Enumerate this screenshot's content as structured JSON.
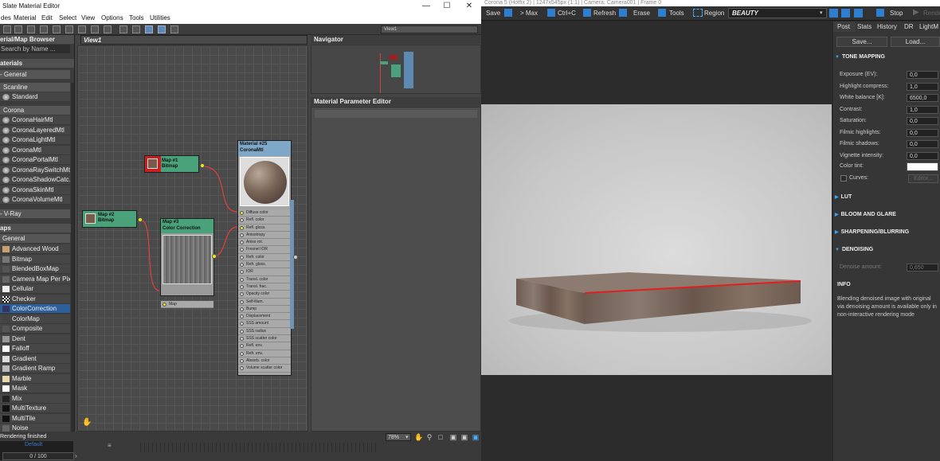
{
  "slate": {
    "title": "Slate Material Editor",
    "menu": [
      "des",
      "Material",
      "Edit",
      "Select",
      "View",
      "Options",
      "Tools",
      "Utilities"
    ],
    "view_dropdown": "View1",
    "browser": {
      "title": "erial/Map Browser",
      "search_placeholder": "Search by Name ...",
      "materials_header": "aterials",
      "general_group": "- General",
      "scanline_group": "Scanline",
      "standard": "Standard",
      "corona_group": "Corona",
      "corona_items": [
        "CoronaHairMtl",
        "CoronaLayeredMtl",
        "CoronaLightMtl",
        "CoronaMtl",
        "CoronaPortalMtl",
        "CoronaRaySwitchMtl",
        "CoronaShadowCatc...",
        "CoronaSkinMtl",
        "CoronaVolumeMtl"
      ],
      "vray_group": "- V-Ray",
      "maps_header": "aps",
      "maps_general": "General",
      "map_items": [
        "Advanced Wood",
        "Bitmap",
        "BlendedBoxMap",
        "Camera Map Per Pixel",
        "Cellular",
        "Checker",
        "ColorCorrection",
        "ColorMap",
        "Composite",
        "Dent",
        "Falloff",
        "Gradient",
        "Gradient Ramp",
        "Marble",
        "Mask",
        "Mix",
        "MultiTexture",
        "MultiTile",
        "Noise"
      ],
      "selected_map": "ColorCorrection"
    },
    "view_tab": "View1",
    "nodes": {
      "map1": {
        "title": "Map #1",
        "subtitle": "Bitmap"
      },
      "map2": {
        "title": "Map #2",
        "subtitle": "Bitmap"
      },
      "map3": {
        "title": "Map #3",
        "subtitle": "Color Correction",
        "slot": "Map"
      },
      "mat": {
        "title": "Material #25",
        "subtitle": "CoronaMtl",
        "slots": [
          "Diffuse color",
          "Refl. color",
          "Refl. gloss.",
          "Anisotropy",
          "Aniso rot.",
          "Fresnel IOR",
          "Refr. color",
          "Refr. gloss.",
          "IOR",
          "Transl. color",
          "Transl. frac.",
          "Opacity color",
          "Self-illum.",
          "Bump",
          "Displacement",
          "SSS amount",
          "SSS radius",
          "SSS scatter color",
          "Refl. env.",
          "Refr. env.",
          "Absorb. color",
          "Volume scatter color"
        ]
      }
    },
    "navigator_title": "Navigator",
    "mpe_title": "Material Parameter Editor",
    "status_text": "Rendering finished",
    "progress_text": "0 / 100",
    "default_label": "Default",
    "zoom": "78%"
  },
  "vfb": {
    "title": "Corona 5 (Hotfix 2) | 1247x545px (1:1) | Camera: Camera001 | Frame 0",
    "toolbar": {
      "save": "Save",
      "max": "> Max",
      "ctrlc": "Ctrl+C",
      "refresh": "Refresh",
      "erase": "Erase",
      "tools": "Tools",
      "region": "Region",
      "pass": "BEAUTY",
      "stop": "Stop",
      "render": "Rende"
    },
    "tabs": [
      "Post",
      "Stats",
      "History",
      "DR",
      "LightM"
    ],
    "save_btn": "Save...",
    "load_btn": "Load...",
    "tone_mapping": "TONE MAPPING",
    "params": [
      {
        "label": "Exposure (EV):",
        "value": "0,0"
      },
      {
        "label": "Highlight compress:",
        "value": "1,0"
      },
      {
        "label": "White balance [K]:",
        "value": "6500,0"
      },
      {
        "label": "Contrast:",
        "value": "1,0"
      },
      {
        "label": "Saturation:",
        "value": "0,0"
      },
      {
        "label": "Filmic highlights:",
        "value": "0,0"
      },
      {
        "label": "Filmic shadows:",
        "value": "0,0"
      },
      {
        "label": "Vignette intensity:",
        "value": "0,0"
      }
    ],
    "color_tint": "Color tint:",
    "curves": "Curves:",
    "curves_btn": "Editor...",
    "lut": "LUT",
    "bloom": "BLOOM AND GLARE",
    "sharpening": "SHARPENING/BLURRING",
    "denoising": "DENOISING",
    "denoise_amount_label": "Denoise amount:",
    "denoise_amount": "0,650",
    "info_title": "INFO",
    "info_text": "Blending denoised image with original via denoising amount is available only in non-interactive rendering mode",
    "colors": {
      "accent": "#3ea0f0",
      "edge_highlight": "#e02020"
    }
  }
}
